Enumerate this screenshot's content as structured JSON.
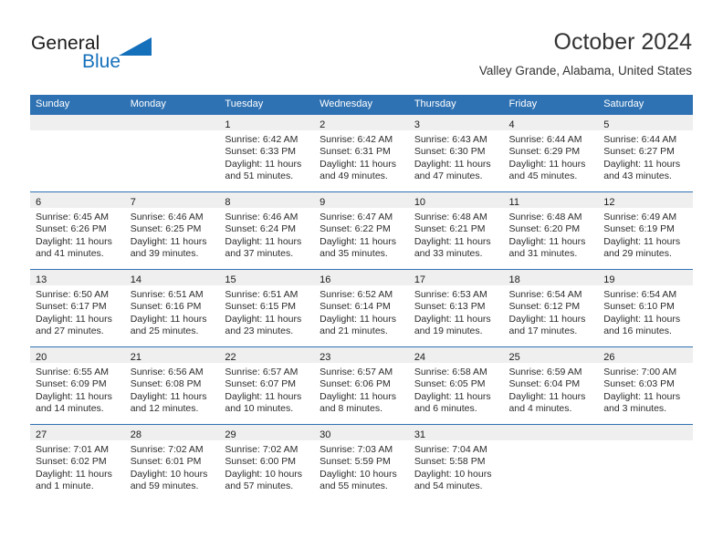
{
  "logo": {
    "word_one": "General",
    "word_two": "Blue",
    "triangle_icon": "triangle-icon",
    "accent_color": "#1570bb"
  },
  "header": {
    "title": "October 2024",
    "location": "Valley Grande, Alabama, United States"
  },
  "theme": {
    "header_blue": "#2f72b3",
    "daynum_strip": "#efefef",
    "text": "#2b2b2b"
  },
  "calendar": {
    "weekday_headers": [
      "Sunday",
      "Monday",
      "Tuesday",
      "Wednesday",
      "Thursday",
      "Friday",
      "Saturday"
    ],
    "weeks": [
      [
        {
          "day": "",
          "lines": []
        },
        {
          "day": "",
          "lines": []
        },
        {
          "day": "1",
          "lines": [
            "Sunrise: 6:42 AM",
            "Sunset: 6:33 PM",
            "Daylight: 11 hours",
            "and 51 minutes."
          ]
        },
        {
          "day": "2",
          "lines": [
            "Sunrise: 6:42 AM",
            "Sunset: 6:31 PM",
            "Daylight: 11 hours",
            "and 49 minutes."
          ]
        },
        {
          "day": "3",
          "lines": [
            "Sunrise: 6:43 AM",
            "Sunset: 6:30 PM",
            "Daylight: 11 hours",
            "and 47 minutes."
          ]
        },
        {
          "day": "4",
          "lines": [
            "Sunrise: 6:44 AM",
            "Sunset: 6:29 PM",
            "Daylight: 11 hours",
            "and 45 minutes."
          ]
        },
        {
          "day": "5",
          "lines": [
            "Sunrise: 6:44 AM",
            "Sunset: 6:27 PM",
            "Daylight: 11 hours",
            "and 43 minutes."
          ]
        }
      ],
      [
        {
          "day": "6",
          "lines": [
            "Sunrise: 6:45 AM",
            "Sunset: 6:26 PM",
            "Daylight: 11 hours",
            "and 41 minutes."
          ]
        },
        {
          "day": "7",
          "lines": [
            "Sunrise: 6:46 AM",
            "Sunset: 6:25 PM",
            "Daylight: 11 hours",
            "and 39 minutes."
          ]
        },
        {
          "day": "8",
          "lines": [
            "Sunrise: 6:46 AM",
            "Sunset: 6:24 PM",
            "Daylight: 11 hours",
            "and 37 minutes."
          ]
        },
        {
          "day": "9",
          "lines": [
            "Sunrise: 6:47 AM",
            "Sunset: 6:22 PM",
            "Daylight: 11 hours",
            "and 35 minutes."
          ]
        },
        {
          "day": "10",
          "lines": [
            "Sunrise: 6:48 AM",
            "Sunset: 6:21 PM",
            "Daylight: 11 hours",
            "and 33 minutes."
          ]
        },
        {
          "day": "11",
          "lines": [
            "Sunrise: 6:48 AM",
            "Sunset: 6:20 PM",
            "Daylight: 11 hours",
            "and 31 minutes."
          ]
        },
        {
          "day": "12",
          "lines": [
            "Sunrise: 6:49 AM",
            "Sunset: 6:19 PM",
            "Daylight: 11 hours",
            "and 29 minutes."
          ]
        }
      ],
      [
        {
          "day": "13",
          "lines": [
            "Sunrise: 6:50 AM",
            "Sunset: 6:17 PM",
            "Daylight: 11 hours",
            "and 27 minutes."
          ]
        },
        {
          "day": "14",
          "lines": [
            "Sunrise: 6:51 AM",
            "Sunset: 6:16 PM",
            "Daylight: 11 hours",
            "and 25 minutes."
          ]
        },
        {
          "day": "15",
          "lines": [
            "Sunrise: 6:51 AM",
            "Sunset: 6:15 PM",
            "Daylight: 11 hours",
            "and 23 minutes."
          ]
        },
        {
          "day": "16",
          "lines": [
            "Sunrise: 6:52 AM",
            "Sunset: 6:14 PM",
            "Daylight: 11 hours",
            "and 21 minutes."
          ]
        },
        {
          "day": "17",
          "lines": [
            "Sunrise: 6:53 AM",
            "Sunset: 6:13 PM",
            "Daylight: 11 hours",
            "and 19 minutes."
          ]
        },
        {
          "day": "18",
          "lines": [
            "Sunrise: 6:54 AM",
            "Sunset: 6:12 PM",
            "Daylight: 11 hours",
            "and 17 minutes."
          ]
        },
        {
          "day": "19",
          "lines": [
            "Sunrise: 6:54 AM",
            "Sunset: 6:10 PM",
            "Daylight: 11 hours",
            "and 16 minutes."
          ]
        }
      ],
      [
        {
          "day": "20",
          "lines": [
            "Sunrise: 6:55 AM",
            "Sunset: 6:09 PM",
            "Daylight: 11 hours",
            "and 14 minutes."
          ]
        },
        {
          "day": "21",
          "lines": [
            "Sunrise: 6:56 AM",
            "Sunset: 6:08 PM",
            "Daylight: 11 hours",
            "and 12 minutes."
          ]
        },
        {
          "day": "22",
          "lines": [
            "Sunrise: 6:57 AM",
            "Sunset: 6:07 PM",
            "Daylight: 11 hours",
            "and 10 minutes."
          ]
        },
        {
          "day": "23",
          "lines": [
            "Sunrise: 6:57 AM",
            "Sunset: 6:06 PM",
            "Daylight: 11 hours",
            "and 8 minutes."
          ]
        },
        {
          "day": "24",
          "lines": [
            "Sunrise: 6:58 AM",
            "Sunset: 6:05 PM",
            "Daylight: 11 hours",
            "and 6 minutes."
          ]
        },
        {
          "day": "25",
          "lines": [
            "Sunrise: 6:59 AM",
            "Sunset: 6:04 PM",
            "Daylight: 11 hours",
            "and 4 minutes."
          ]
        },
        {
          "day": "26",
          "lines": [
            "Sunrise: 7:00 AM",
            "Sunset: 6:03 PM",
            "Daylight: 11 hours",
            "and 3 minutes."
          ]
        }
      ],
      [
        {
          "day": "27",
          "lines": [
            "Sunrise: 7:01 AM",
            "Sunset: 6:02 PM",
            "Daylight: 11 hours",
            "and 1 minute."
          ]
        },
        {
          "day": "28",
          "lines": [
            "Sunrise: 7:02 AM",
            "Sunset: 6:01 PM",
            "Daylight: 10 hours",
            "and 59 minutes."
          ]
        },
        {
          "day": "29",
          "lines": [
            "Sunrise: 7:02 AM",
            "Sunset: 6:00 PM",
            "Daylight: 10 hours",
            "and 57 minutes."
          ]
        },
        {
          "day": "30",
          "lines": [
            "Sunrise: 7:03 AM",
            "Sunset: 5:59 PM",
            "Daylight: 10 hours",
            "and 55 minutes."
          ]
        },
        {
          "day": "31",
          "lines": [
            "Sunrise: 7:04 AM",
            "Sunset: 5:58 PM",
            "Daylight: 10 hours",
            "and 54 minutes."
          ]
        },
        {
          "day": "",
          "lines": []
        },
        {
          "day": "",
          "lines": []
        }
      ]
    ]
  }
}
